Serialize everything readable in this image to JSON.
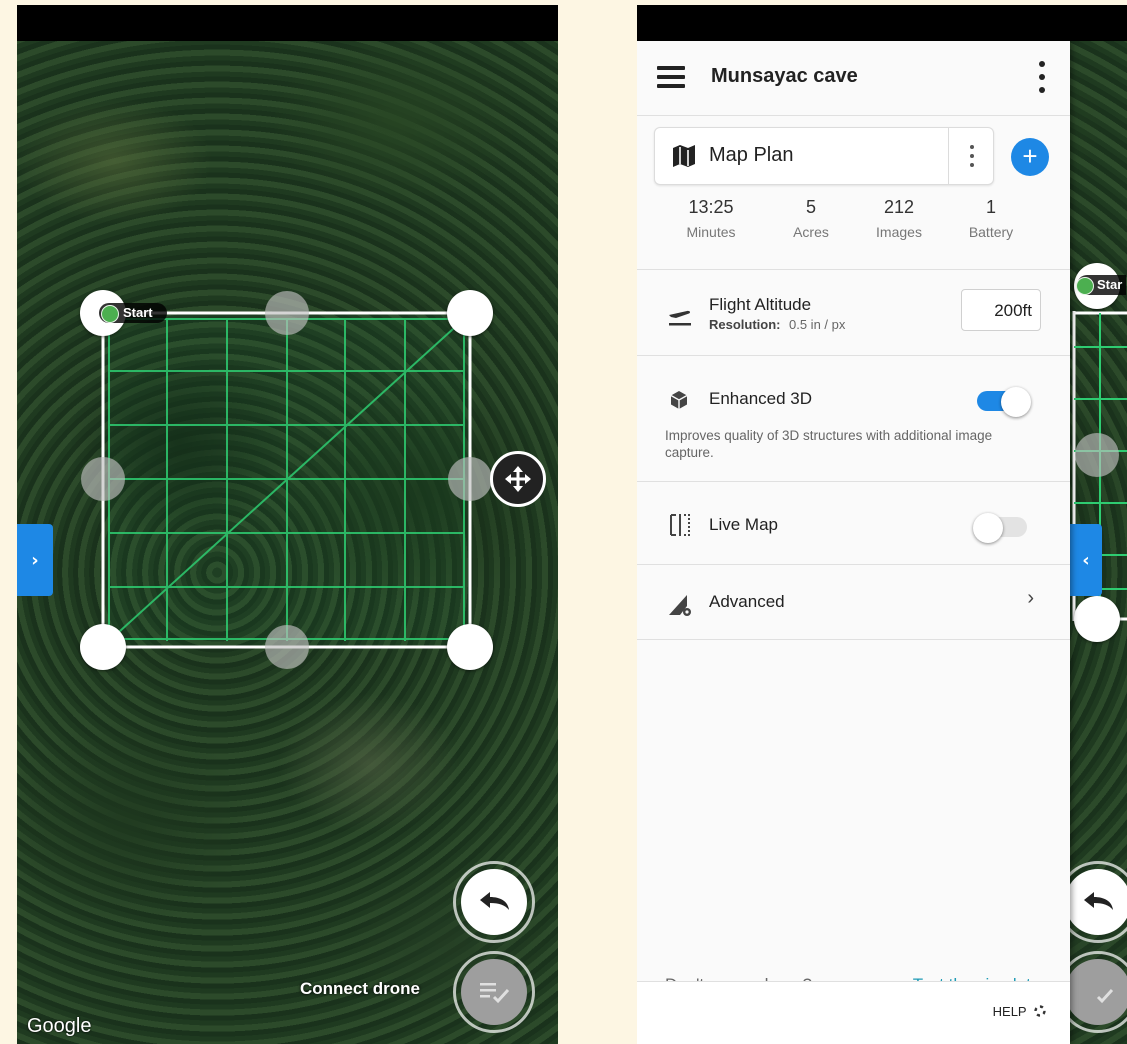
{
  "left_screen": {
    "map": {
      "attribution": "Google"
    },
    "start_label": "Start",
    "expand_tab_glyph": "›",
    "connect_label": "Connect drone",
    "icons": {
      "move": "move-arrows-icon",
      "undo": "undo-icon",
      "checklist": "checklist-icon"
    }
  },
  "right_screen": {
    "header": {
      "title": "Munsayac cave"
    },
    "plan": {
      "name": "Map Plan",
      "add_glyph": "+"
    },
    "stats": [
      {
        "value": "13:25",
        "label": "Minutes"
      },
      {
        "value": "5",
        "label": "Acres"
      },
      {
        "value": "212",
        "label": "Images"
      },
      {
        "value": "1",
        "label": "Battery"
      }
    ],
    "flight_altitude": {
      "title": "Flight Altitude",
      "resolution_label": "Resolution:",
      "resolution_value": "0.5 in / px",
      "value": "200ft"
    },
    "enhanced_3d": {
      "title": "Enhanced 3D",
      "description": "Improves quality of 3D structures with additional image capture.",
      "enabled": true
    },
    "live_map": {
      "title": "Live Map",
      "enabled": false
    },
    "advanced": {
      "title": "Advanced",
      "chevron": "›"
    },
    "footer": {
      "question": "Don't own a drone?",
      "link": "Test the simulator",
      "help": "HELP"
    },
    "collapse_tab_glyph": "‹",
    "peek_start_label": "Star"
  },
  "colors": {
    "accent": "#1e88e5",
    "grid_line": "#2ecc71",
    "link": "#1e9bb5",
    "start_dot": "#4caf50"
  }
}
